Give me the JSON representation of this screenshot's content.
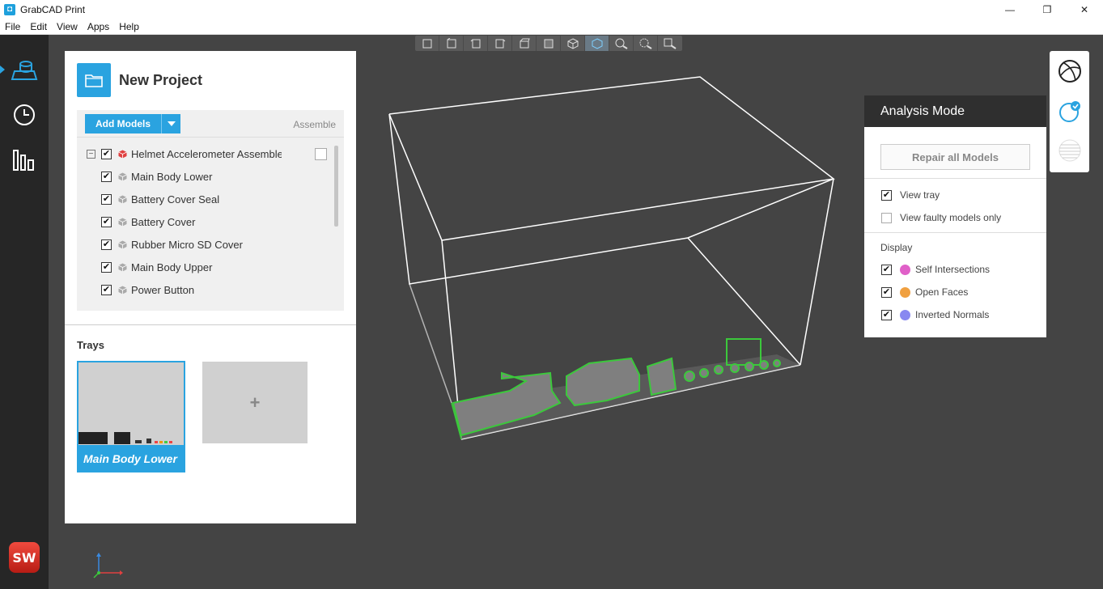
{
  "window": {
    "title": "GrabCAD Print",
    "controls": [
      "—",
      "❐",
      "✕"
    ]
  },
  "menu": [
    "File",
    "Edit",
    "View",
    "Apps",
    "Help"
  ],
  "project": {
    "title": "New Project",
    "add_models_label": "Add Models",
    "assemble_label": "Assemble",
    "assembly": {
      "name": "Helmet Accelerometer Assemble",
      "checked": true
    },
    "models": [
      {
        "name": "Main Body Lower",
        "checked": true
      },
      {
        "name": "Battery Cover Seal",
        "checked": true
      },
      {
        "name": "Battery Cover",
        "checked": true
      },
      {
        "name": "Rubber Micro SD Cover",
        "checked": true
      },
      {
        "name": "Main Body Upper",
        "checked": true
      },
      {
        "name": "Power Button",
        "checked": true
      }
    ],
    "trays_title": "Trays",
    "trays": [
      {
        "label": "Main Body Lower",
        "selected": true
      }
    ],
    "add_tray_symbol": "+"
  },
  "analysis": {
    "title": "Analysis Mode",
    "repair_label": "Repair all Models",
    "view_tray_label": "View tray",
    "view_tray_checked": true,
    "view_faulty_label": "View faulty models only",
    "view_faulty_checked": false,
    "display_title": "Display",
    "display_items": [
      {
        "label": "Self Intersections",
        "color": "#e060c8",
        "checked": true
      },
      {
        "label": "Open Faces",
        "color": "#f0a040",
        "checked": true
      },
      {
        "label": "Inverted Normals",
        "color": "#8888f0",
        "checked": true
      }
    ]
  },
  "colors": {
    "accent": "#2aa3e0",
    "sidebar": "#262626",
    "viewport": "#444444",
    "model_outline": "#3cc83c"
  },
  "icons": {
    "left_nav": [
      "printer-tray-icon",
      "history-clock-icon",
      "queue-bars-icon"
    ],
    "right_tools": [
      "materials-sphere-icon",
      "analysis-check-icon",
      "slice-layers-icon"
    ],
    "view_tools": [
      "view-front-icon",
      "view-back-icon",
      "view-left-icon",
      "view-right-icon",
      "view-top-icon",
      "view-bottom-icon",
      "view-iso-icon",
      "view-perspective-icon",
      "zoom-fit-icon",
      "zoom-selection-icon",
      "zoom-area-icon"
    ],
    "sw_logo": "SW"
  }
}
